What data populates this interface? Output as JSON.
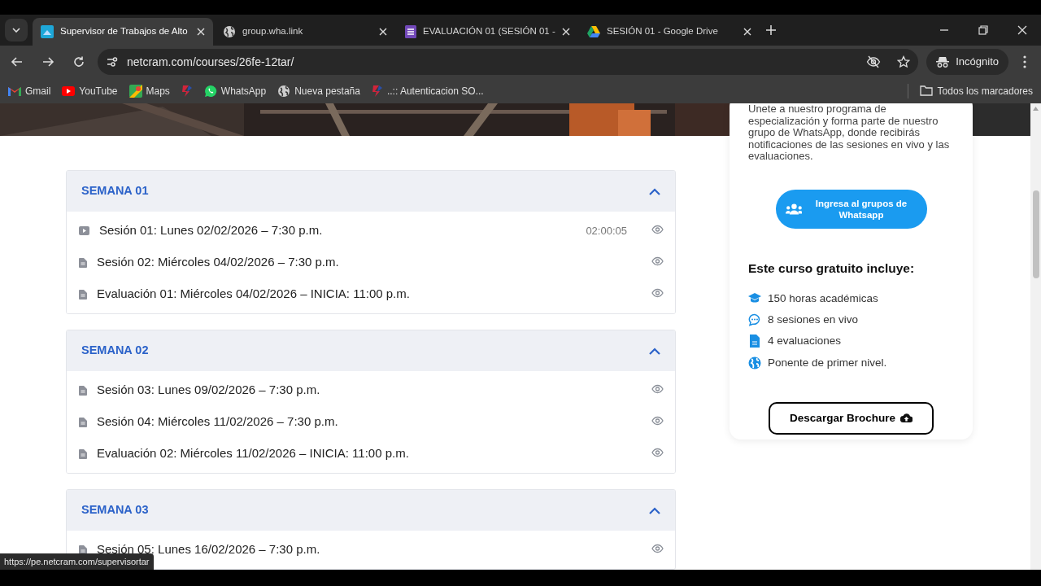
{
  "browser": {
    "tabs": [
      {
        "title": "Supervisor de Trabajos de Alto",
        "selected": true
      },
      {
        "title": "group.wha.link",
        "selected": false
      },
      {
        "title": "EVALUACIÓN 01 (SESIÓN 01 -",
        "selected": false
      },
      {
        "title": "SESIÓN 01 - Google Drive",
        "selected": false
      }
    ],
    "url": "netcram.com/courses/26fe-12tar/",
    "profile": "Incógnito",
    "bookmarks": [
      {
        "kind": "link",
        "label": "Gmail"
      },
      {
        "kind": "link",
        "label": "YouTube"
      },
      {
        "kind": "link",
        "label": "Maps"
      },
      {
        "kind": "icon"
      },
      {
        "kind": "link",
        "label": "WhatsApp"
      },
      {
        "kind": "link",
        "label": "Nueva pestaña"
      },
      {
        "kind": "link",
        "label": "..:: Autenticacion SO..."
      }
    ],
    "all_bookmarks": "Todos los marcadores"
  },
  "weeks": [
    {
      "title": "SEMANA 01",
      "expanded": true,
      "lessons": [
        {
          "kind": "video",
          "title": "Sesión 01: Lunes 02/02/2026 – 7:30 p.m.",
          "duration": "02:00:05"
        },
        {
          "kind": "doc",
          "title": "Sesión 02: Miércoles 04/02/2026 – 7:30 p.m."
        },
        {
          "kind": "doc",
          "title": "Evaluación 01: Miércoles 04/02/2026 – INICIA: 11:00 p.m."
        }
      ]
    },
    {
      "title": "SEMANA 02",
      "expanded": true,
      "lessons": [
        {
          "kind": "doc",
          "title": "Sesión 03: Lunes 09/02/2026 – 7:30 p.m."
        },
        {
          "kind": "doc",
          "title": "Sesión 04: Miércoles 11/02/2026 – 7:30 p.m."
        },
        {
          "kind": "doc",
          "title": "Evaluación 02: Miércoles 11/02/2026 – INICIA: 11:00 p.m."
        }
      ]
    },
    {
      "title": "SEMANA 03",
      "expanded": true,
      "lessons": [
        {
          "kind": "doc",
          "title": "Sesión 05: Lunes 16/02/2026 – 7:30 p.m."
        }
      ]
    }
  ],
  "sidebar": {
    "intro": "Unete a nuestro programa de especialización y forma parte de nuestro grupo de WhatsApp, donde recibirás notificaciones de las sesiones en vivo y las evaluaciones.",
    "whatsapp_button": "Ingresa al grupos de Whatsapp",
    "includes_title": "Este curso gratuito incluye:",
    "includes": [
      "150 horas académicas",
      "8 sesiones en vivo",
      "4 evaluaciones",
      "Ponente de primer nivel."
    ],
    "brochure_button": "Descargar Brochure"
  },
  "status_url": "https://pe.netcram.com/supervisortar"
}
